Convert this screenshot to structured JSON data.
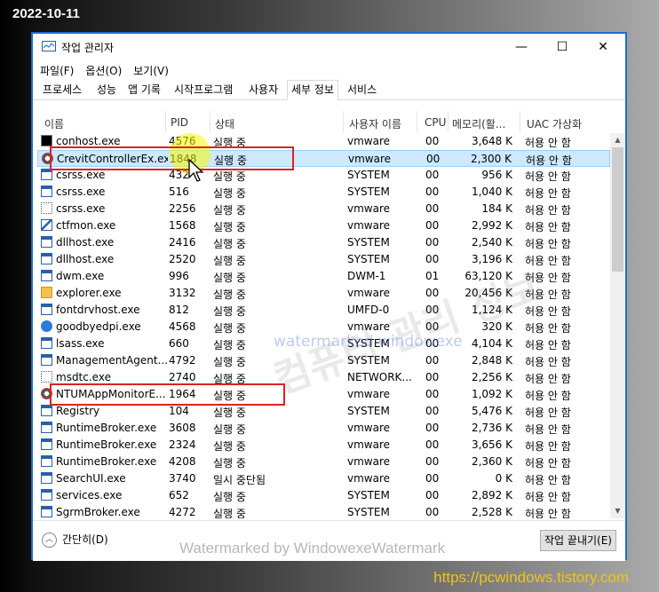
{
  "overlay": {
    "date": "2022-10-11",
    "url": "https://pcwindows.tistory.com",
    "watermark_center": "컴퓨터 관리 정보",
    "watermark_blue": "watermarked windowexe",
    "watermark_bottom": "Watermarked by WindowexeWatermark"
  },
  "window": {
    "title": "작업 관리자",
    "min": "—",
    "max": "☐",
    "close": "✕"
  },
  "menu": [
    "파일(F)",
    "옵션(O)",
    "보기(V)"
  ],
  "tabs": [
    "프로세스",
    "성능",
    "앱 기록",
    "시작프로그램",
    "사용자",
    "세부 정보",
    "서비스"
  ],
  "active_tab": "세부 정보",
  "columns": {
    "name": "이름",
    "pid": "PID",
    "status": "상태",
    "user": "사용자 이름",
    "cpu": "CPU",
    "mem": "메모리(활...",
    "uac": "UAC 가상화"
  },
  "processes": [
    {
      "name": "conhost.exe",
      "pid": "4576",
      "status": "실행 중",
      "user": "vmware",
      "cpu": "00",
      "mem": "3,648 K",
      "uac": "허용 안 함",
      "icon": "console-icon"
    },
    {
      "name": "CrevitControllerEx.exe",
      "pid": "1848",
      "status": "실행 중",
      "user": "vmware",
      "cpu": "00",
      "mem": "2,300 K",
      "uac": "허용 안 함",
      "icon": "gear-icon",
      "selected": true
    },
    {
      "name": "csrss.exe",
      "pid": "432",
      "status": "실행 중",
      "user": "SYSTEM",
      "cpu": "00",
      "mem": "956 K",
      "uac": "허용 안 함",
      "icon": "app-window-icon"
    },
    {
      "name": "csrss.exe",
      "pid": "516",
      "status": "실행 중",
      "user": "SYSTEM",
      "cpu": "00",
      "mem": "1,040 K",
      "uac": "허용 안 함",
      "icon": "app-window-icon"
    },
    {
      "name": "csrss.exe",
      "pid": "2256",
      "status": "실행 중",
      "user": "vmware",
      "cpu": "00",
      "mem": "184 K",
      "uac": "허용 안 함",
      "icon": "cursor-icon"
    },
    {
      "name": "ctfmon.exe",
      "pid": "1568",
      "status": "실행 중",
      "user": "vmware",
      "cpu": "00",
      "mem": "2,992 K",
      "uac": "허용 안 함",
      "icon": "pen-icon"
    },
    {
      "name": "dllhost.exe",
      "pid": "2416",
      "status": "실행 중",
      "user": "SYSTEM",
      "cpu": "00",
      "mem": "2,540 K",
      "uac": "허용 안 함",
      "icon": "app-window-icon"
    },
    {
      "name": "dllhost.exe",
      "pid": "2520",
      "status": "실행 중",
      "user": "SYSTEM",
      "cpu": "00",
      "mem": "3,196 K",
      "uac": "허용 안 함",
      "icon": "app-window-icon"
    },
    {
      "name": "dwm.exe",
      "pid": "996",
      "status": "실행 중",
      "user": "DWM-1",
      "cpu": "01",
      "mem": "63,120 K",
      "uac": "허용 안 함",
      "icon": "app-window-icon"
    },
    {
      "name": "explorer.exe",
      "pid": "3132",
      "status": "실행 중",
      "user": "vmware",
      "cpu": "00",
      "mem": "20,456 K",
      "uac": "허용 안 함",
      "icon": "folder-icon"
    },
    {
      "name": "fontdrvhost.exe",
      "pid": "812",
      "status": "실행 중",
      "user": "UMFD-0",
      "cpu": "00",
      "mem": "1,124 K",
      "uac": "허용 안 함",
      "icon": "app-window-icon"
    },
    {
      "name": "goodbyedpi.exe",
      "pid": "4568",
      "status": "실행 중",
      "user": "vmware",
      "cpu": "00",
      "mem": "320 K",
      "uac": "허용 안 함",
      "icon": "globe-icon"
    },
    {
      "name": "lsass.exe",
      "pid": "660",
      "status": "실행 중",
      "user": "SYSTEM",
      "cpu": "00",
      "mem": "4,104 K",
      "uac": "허용 안 함",
      "icon": "app-window-icon"
    },
    {
      "name": "ManagementAgent...",
      "pid": "4792",
      "status": "실행 중",
      "user": "SYSTEM",
      "cpu": "00",
      "mem": "2,848 K",
      "uac": "허용 안 함",
      "icon": "app-window-icon"
    },
    {
      "name": "msdtc.exe",
      "pid": "2740",
      "status": "실행 중",
      "user": "NETWORK...",
      "cpu": "00",
      "mem": "2,256 K",
      "uac": "허용 안 함",
      "icon": "cursor-icon"
    },
    {
      "name": "NTUMAppMonitorE...",
      "pid": "1964",
      "status": "실행 중",
      "user": "vmware",
      "cpu": "00",
      "mem": "1,092 K",
      "uac": "허용 안 함",
      "icon": "gear-icon"
    },
    {
      "name": "Registry",
      "pid": "104",
      "status": "실행 중",
      "user": "SYSTEM",
      "cpu": "00",
      "mem": "5,476 K",
      "uac": "허용 안 함",
      "icon": "app-window-icon"
    },
    {
      "name": "RuntimeBroker.exe",
      "pid": "3608",
      "status": "실행 중",
      "user": "vmware",
      "cpu": "00",
      "mem": "2,736 K",
      "uac": "허용 안 함",
      "icon": "app-window-icon"
    },
    {
      "name": "RuntimeBroker.exe",
      "pid": "2324",
      "status": "실행 중",
      "user": "vmware",
      "cpu": "00",
      "mem": "3,656 K",
      "uac": "허용 안 함",
      "icon": "app-window-icon"
    },
    {
      "name": "RuntimeBroker.exe",
      "pid": "4208",
      "status": "실행 중",
      "user": "vmware",
      "cpu": "00",
      "mem": "2,360 K",
      "uac": "허용 안 함",
      "icon": "app-window-icon"
    },
    {
      "name": "SearchUI.exe",
      "pid": "3740",
      "status": "일시 중단됨",
      "user": "vmware",
      "cpu": "00",
      "mem": "0 K",
      "uac": "허용 안 함",
      "icon": "app-window-icon"
    },
    {
      "name": "services.exe",
      "pid": "652",
      "status": "실행 중",
      "user": "SYSTEM",
      "cpu": "00",
      "mem": "2,892 K",
      "uac": "허용 안 함",
      "icon": "app-window-icon"
    },
    {
      "name": "SgrmBroker.exe",
      "pid": "4272",
      "status": "실행 중",
      "user": "SYSTEM",
      "cpu": "00",
      "mem": "2,528 K",
      "uac": "허용 안 함",
      "icon": "app-window-icon"
    }
  ],
  "footer": {
    "fewer": "간단히(D)",
    "end_task": "작업 끝내기(E)"
  },
  "colors": {
    "selection": "#cde8ff",
    "annotation_red": "#e02020",
    "window_border": "#1b6ccf",
    "url_text": "#f0c419"
  }
}
